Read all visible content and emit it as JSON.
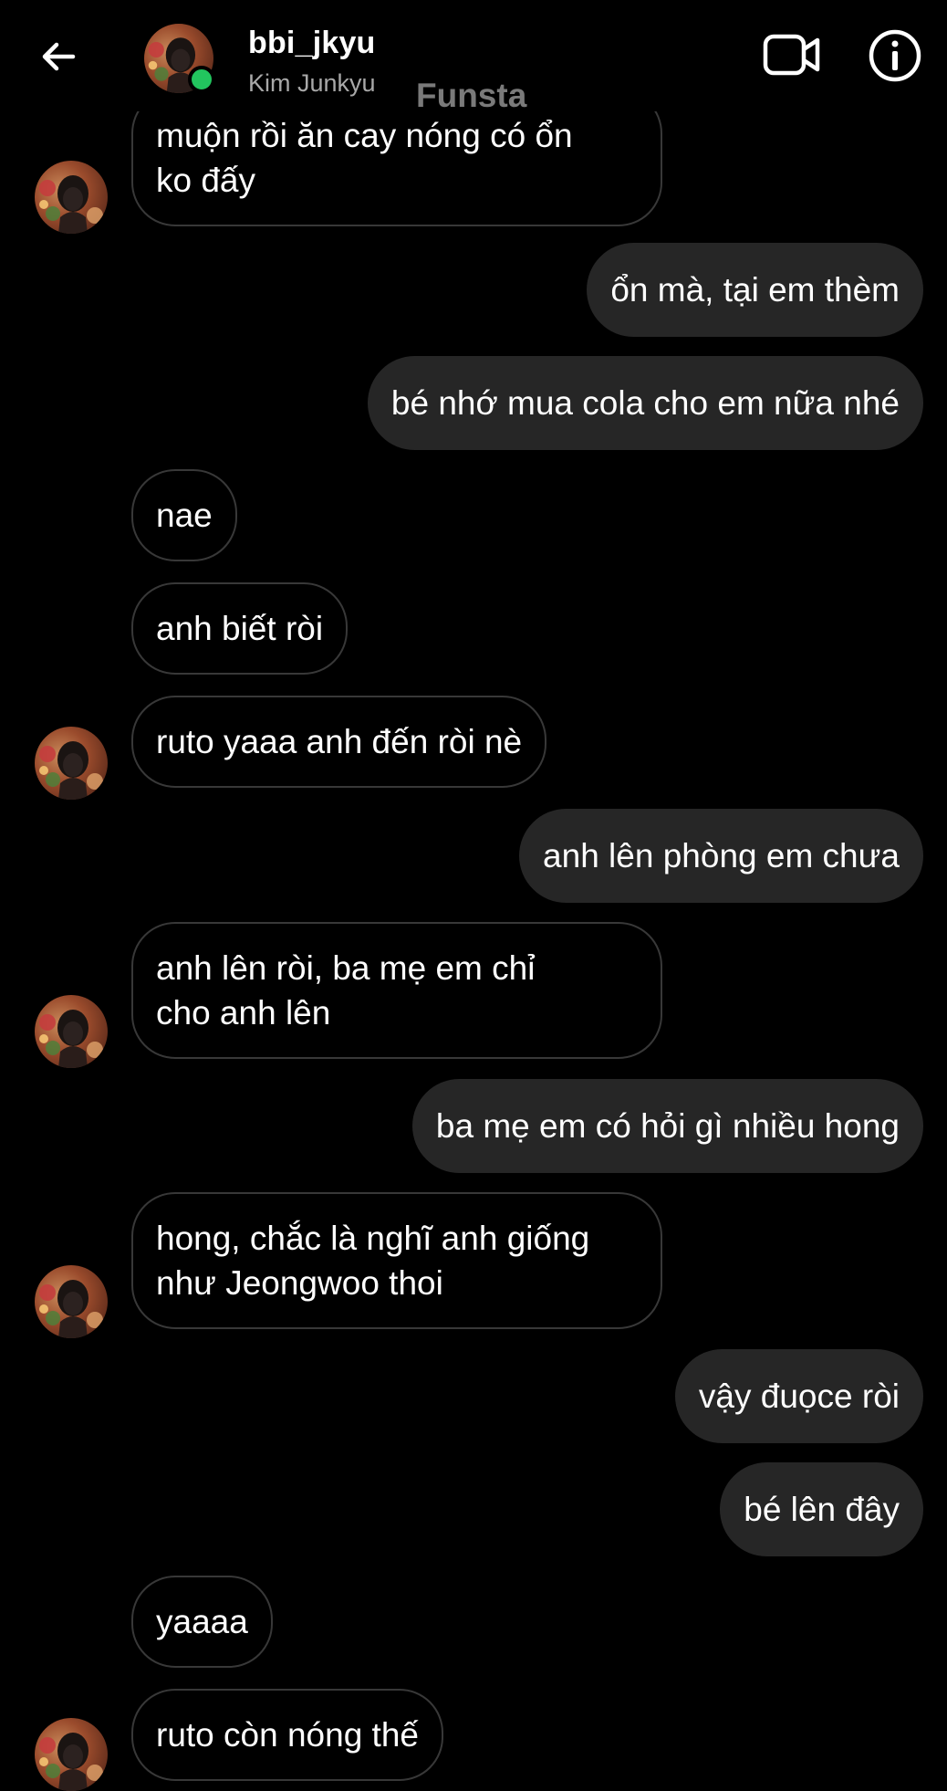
{
  "header": {
    "username": "bbi_jkyu",
    "full_name": "Kim Junkyu",
    "watermark": "Funsta",
    "back_icon": "arrow-left-icon",
    "video_icon": "video-camera-icon",
    "info_icon": "info-circle-icon",
    "online_color": "#22c55e"
  },
  "colors": {
    "background": "#000000",
    "outgoing_bubble": "#262626",
    "incoming_border": "#383838",
    "text": "#ffffff",
    "secondary_text": "#a8a8a8"
  },
  "messages": [
    {
      "direction": "in",
      "text": "muộn rồi ăn cay nóng có ổn\nko đấy"
    },
    {
      "direction": "out",
      "text": "ổn mà, tại em thèm"
    },
    {
      "direction": "out",
      "text": "bé nhớ mua cola cho em nữa nhé"
    },
    {
      "direction": "in",
      "text": "nae"
    },
    {
      "direction": "in",
      "text": "anh biết ròi"
    },
    {
      "direction": "in",
      "text": "ruto yaaa anh đến ròi nè"
    },
    {
      "direction": "out",
      "text": "anh lên phòng em chưa"
    },
    {
      "direction": "in",
      "text": "anh lên ròi, ba mẹ em chỉ\ncho anh lên"
    },
    {
      "direction": "out",
      "text": "ba mẹ em có hỏi gì nhiều hong"
    },
    {
      "direction": "in",
      "text": "hong, chắc là nghĩ anh giống\nnhư Jeongwoo thoi"
    },
    {
      "direction": "out",
      "text": "vậy đuọce ròi"
    },
    {
      "direction": "out",
      "text": "bé lên đây"
    },
    {
      "direction": "in",
      "text": "yaaaa"
    },
    {
      "direction": "in",
      "text": "ruto còn nóng thế"
    }
  ]
}
